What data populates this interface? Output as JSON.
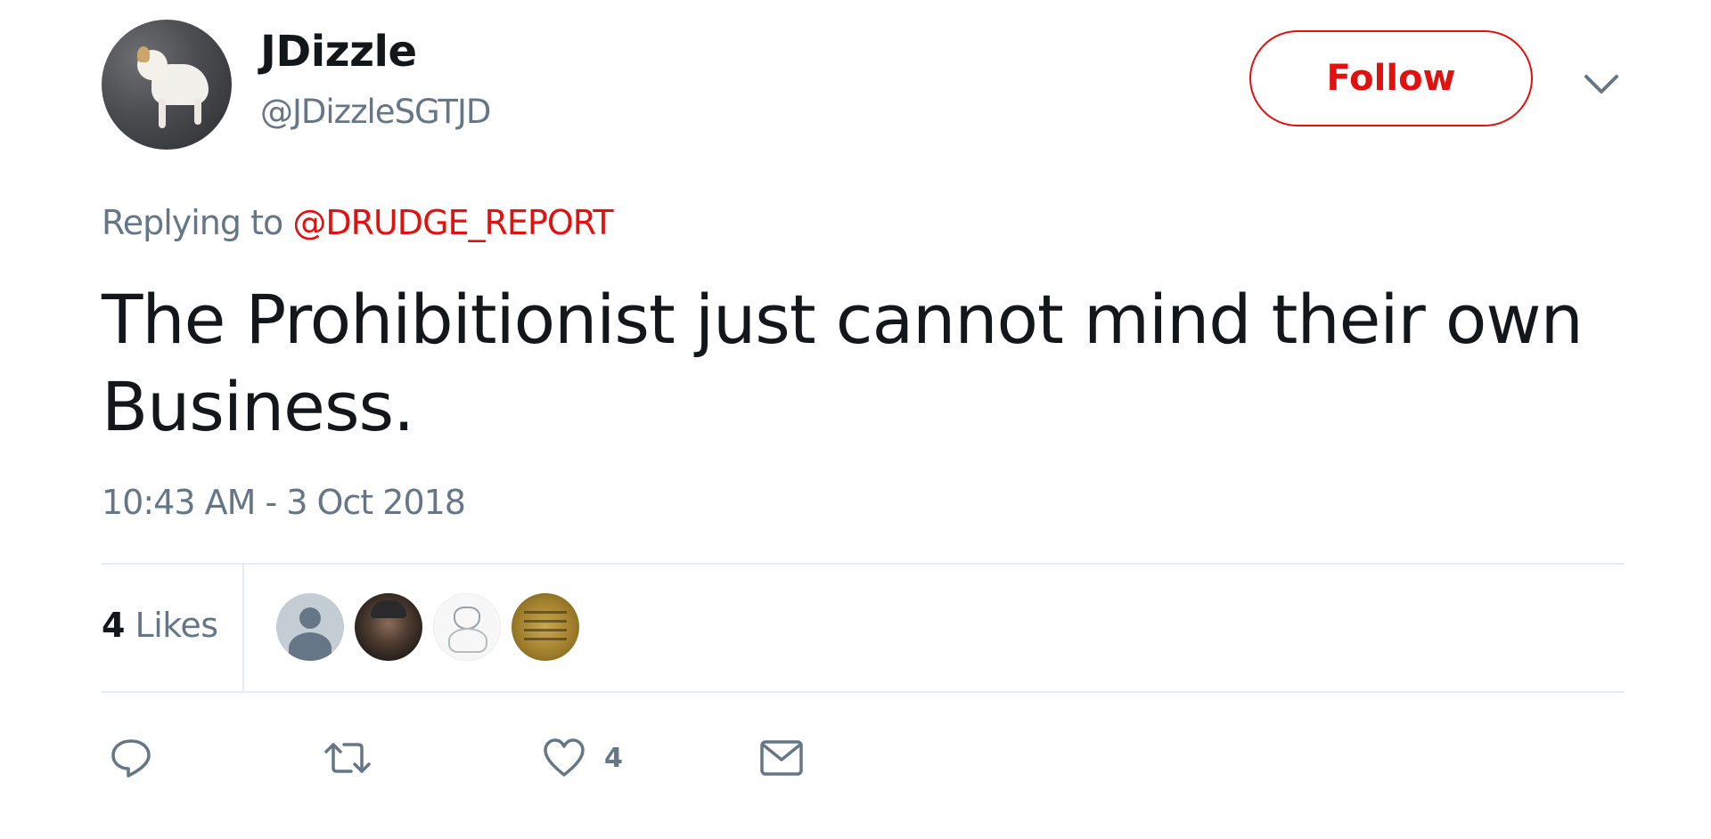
{
  "user": {
    "display_name": "JDizzle",
    "handle": "@JDizzleSGTJD"
  },
  "follow_button": {
    "label": "Follow"
  },
  "reply": {
    "prefix": "Replying to",
    "mention": "@DRUDGE_REPORT"
  },
  "tweet": {
    "line1": "The Prohibitionist just cannot mind their own",
    "line2": "Business.",
    "timestamp": "10:43 AM - 3 Oct 2018"
  },
  "stats": {
    "likes_count": "4",
    "likes_label": "Likes"
  },
  "actions": {
    "like_count": "4"
  },
  "colors": {
    "accent": "#e0110f",
    "secondary_text": "#657786",
    "primary_text": "#14171a",
    "divider": "#e6ecf0"
  },
  "icons": [
    "chevron-down-icon",
    "reply-icon",
    "retweet-icon",
    "heart-icon",
    "envelope-icon"
  ]
}
